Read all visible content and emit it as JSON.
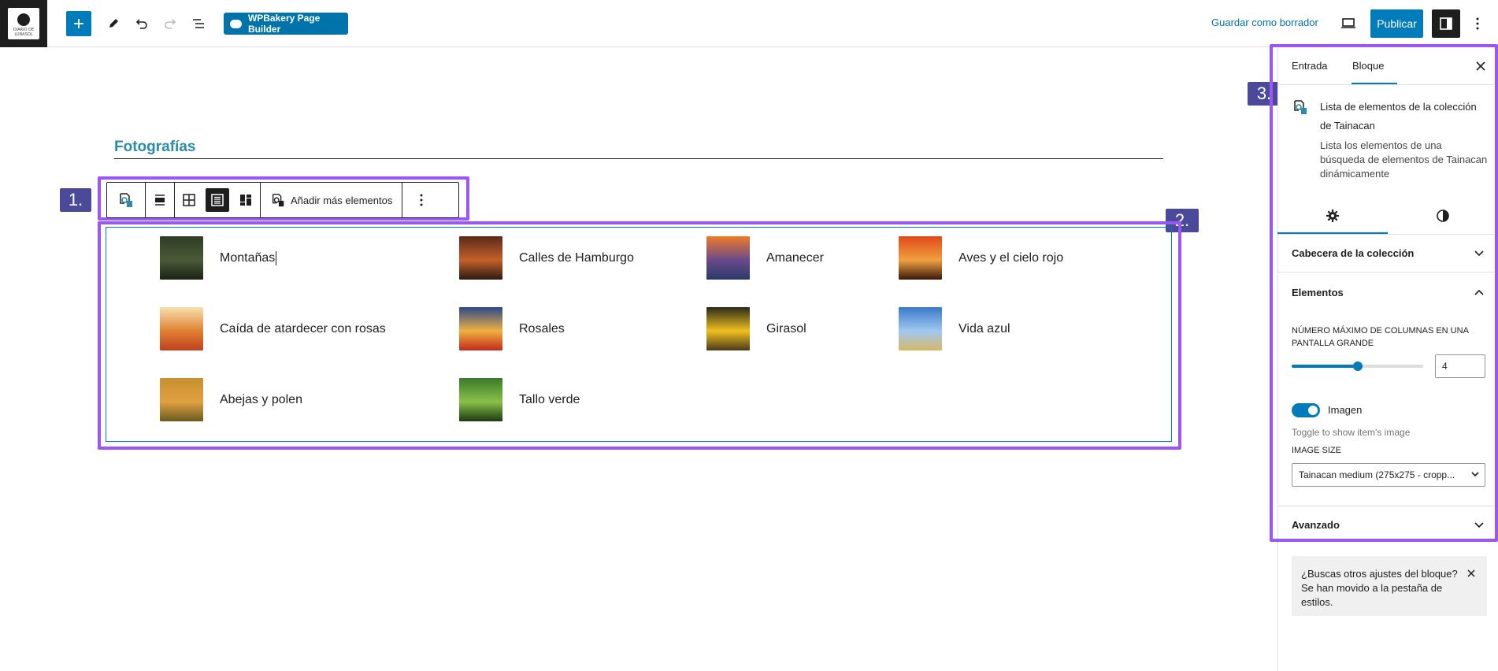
{
  "topbar": {
    "logo_text": "DIARIO DE LUNASOL",
    "wpbakery_label": "WPBakery Page Builder",
    "draft_label": "Guardar como borrador",
    "publish_label": "Publicar"
  },
  "editor": {
    "heading": "Fotografías",
    "callouts": [
      "1.",
      "2.",
      "3."
    ],
    "toolbar": {
      "add_more_label": "Añadir más elementos"
    },
    "items": [
      {
        "label": "Montañas",
        "colors": [
          "#2e3b24",
          "#4a5a38",
          "#1a2214"
        ]
      },
      {
        "label": "Calles de Hamburgo",
        "colors": [
          "#5a2a1a",
          "#c4602a",
          "#2a1a12"
        ]
      },
      {
        "label": "Amanecer",
        "colors": [
          "#f07a2a",
          "#6a4a8a",
          "#2a3a6a"
        ]
      },
      {
        "label": "Aves y el cielo rojo",
        "colors": [
          "#e04a1a",
          "#f0a040",
          "#3a1a0a"
        ]
      },
      {
        "label": "Caída de atardecer con rosas",
        "colors": [
          "#f8e0b0",
          "#e08030",
          "#c04020"
        ]
      },
      {
        "label": "Rosales",
        "colors": [
          "#2a4a8a",
          "#f0b040",
          "#c02a1a"
        ]
      },
      {
        "label": "Girasol",
        "colors": [
          "#2a2a1a",
          "#f0c020",
          "#4a3a1a"
        ]
      },
      {
        "label": "Vida azul",
        "colors": [
          "#3a7ac8",
          "#a0c8f0",
          "#d8b868"
        ]
      },
      {
        "label": "Abejas y polen",
        "colors": [
          "#c89030",
          "#e0a040",
          "#6a5a20"
        ]
      },
      {
        "label": "Tallo verde",
        "colors": [
          "#3a7a2a",
          "#8ac04a",
          "#1a3a12"
        ]
      }
    ]
  },
  "sidebar": {
    "tabs": [
      "Entrada",
      "Bloque"
    ],
    "block_title": "Lista de elementos de la colección de Tainacan",
    "block_desc": "Lista los elementos de una búsqueda de elementos de Tainacan dinámicamente",
    "panels": {
      "header": "Cabecera de la colección",
      "elements": "Elementos",
      "advanced": "Avanzado"
    },
    "columns_label": "NÚMERO MÁXIMO DE COLUMNAS EN UNA PANTALLA GRANDE",
    "columns_value": "4",
    "columns_fraction": 0.5,
    "toggle_label": "Imagen",
    "toggle_on": true,
    "toggle_help": "Toggle to show item's image",
    "image_size_label": "IMAGE SIZE",
    "image_size_value": "Tainacan medium (275x275 - cropp...",
    "notice": "¿Buscas otros ajustes del bloque? Se han movido a la pestaña de estilos."
  },
  "colors": {
    "accent": "#007cba",
    "highlight": "#9b56f5",
    "callout": "#4b4a9a",
    "heading": "#2b8bab"
  }
}
